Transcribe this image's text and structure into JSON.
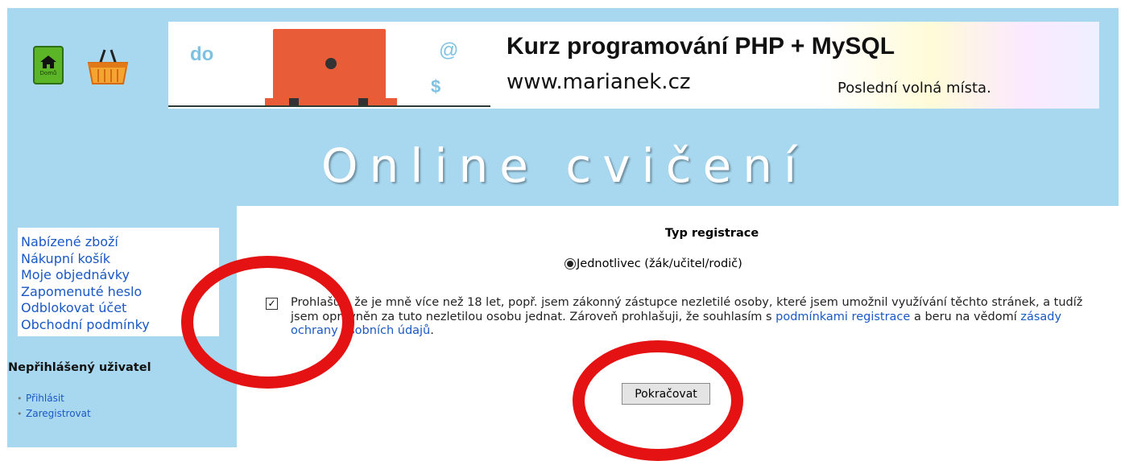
{
  "header": {
    "home_label": "Domů",
    "site_title": "Online cvičení"
  },
  "banner": {
    "left_word": "do",
    "at_sign": "@",
    "dollar_sign": "$",
    "title": "Kurz programování PHP + MySQL",
    "url": "www.marianek.cz",
    "subtitle": "Poslední volná místa."
  },
  "sidebar": {
    "menu": [
      {
        "label": "Nabízené zboží"
      },
      {
        "label": "Nákupní košík"
      },
      {
        "label": "Moje objednávky"
      },
      {
        "label": "Zapomenuté heslo"
      },
      {
        "label": "Odblokovat účet"
      },
      {
        "label": "Obchodní podmínky"
      }
    ],
    "user_heading": "Nepřihlášený uživatel",
    "user_links": [
      {
        "label": "Přihlásit"
      },
      {
        "label": "Zaregistrovat"
      }
    ]
  },
  "main": {
    "registration_type_heading": "Typ registrace",
    "radio_option": "Jednotlivec (žák/učitel/rodič)",
    "checkbox_mark": "✓",
    "declaration_text_1": "Prohlašuji, že je mně více než 18 let, popř. jsem zákonný zástupce nezletilé osoby, které jsem umožnil využívání těchto stránek, a tudíž jsem oprávněn za tuto nezletilou osobu jednat. Zároveň prohlašuji, že souhlasím s ",
    "declaration_link_1": "podmínkami registrace",
    "declaration_text_2": " a beru na vědomí ",
    "declaration_link_2": "zásady ochrany osobních údajů",
    "declaration_text_3": ".",
    "continue_button": "Pokračovat"
  },
  "colors": {
    "header_bg": "#a8d8ef",
    "link": "#1a58c4",
    "highlight_ring": "#e41212"
  }
}
